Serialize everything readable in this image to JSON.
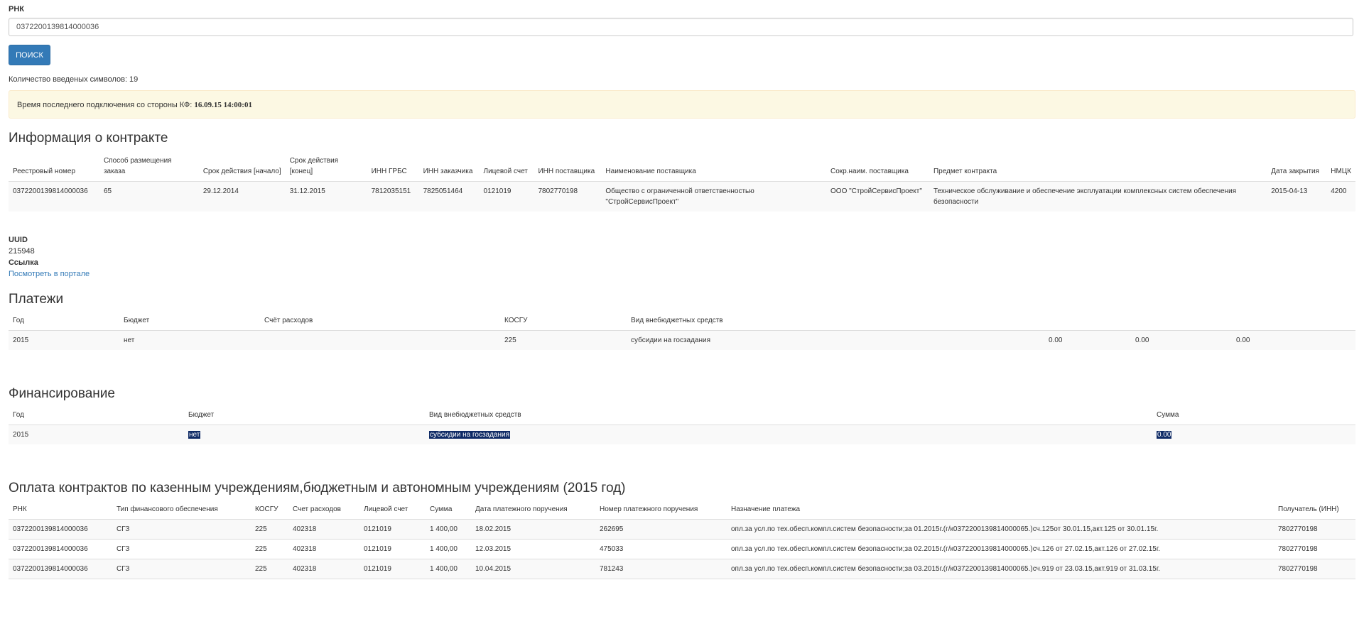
{
  "search": {
    "label": "РНК",
    "value": "0372200139814000036",
    "button": "ПОИСК",
    "char_count": "Количество введеных символов: 19"
  },
  "alert": {
    "text": "Время последнего подключения со стороны КФ: ",
    "timestamp": "16.09.15 14:00:01"
  },
  "contract": {
    "title": "Информация о контракте",
    "headers": [
      "Реестровый номер",
      "Способ размещения заказа",
      "Срок действия [начало]",
      "Срок действия [конец]",
      "ИНН ГРБС",
      "ИНН заказчика",
      "Лицевой счет",
      "ИНН поставщика",
      "Наименование поставщика",
      "Сокр.наим. поставщика",
      "Предмет контракта",
      "Дата закрытия",
      "НМЦК"
    ],
    "row": [
      "0372200139814000036",
      "65",
      "29.12.2014",
      "31.12.2015",
      "7812035151",
      "7825051464",
      "0121019",
      "7802770198",
      "Общество с ограниченной ответственностью \"СтройСервисПроект\"",
      "ООО \"СтройСервисПроект\"",
      "Техническое обслуживание и обеспечение эксплуатации комплексных систем обеспечения безопасности",
      "2015-04-13",
      "4200"
    ]
  },
  "info": {
    "uuid_label": "UUID",
    "uuid_value": "215948",
    "link_label": "Ссылка",
    "link_text": "Посмотреть в портале"
  },
  "payments": {
    "title": "Платежи",
    "headers": [
      "Год",
      "Бюджет",
      "Счёт расходов",
      "КОСГУ",
      "Вид внебюджетных средств",
      "",
      "",
      "",
      ""
    ],
    "row": [
      "2015",
      "нет",
      "",
      "225",
      "субсидии на госзадания",
      "0.00",
      "0.00",
      "0.00",
      ""
    ]
  },
  "financing": {
    "title": "Финансирование",
    "headers": [
      "Год",
      "Бюджет",
      "Вид внебюджетных средств",
      "Сумма"
    ],
    "row": [
      "2015",
      "нет",
      "субсидии на госзадания",
      "0.00"
    ]
  },
  "contract_payments": {
    "title": "Оплата контрактов по казенным учреждениям,бюджетным и автономным учреждениям (2015 год)",
    "headers": [
      "РНК",
      "Тип финансового обеспечения",
      "КОСГУ",
      "Счет расходов",
      "Лицевой счет",
      "Сумма",
      "Дата платежного поручения",
      "Номер платежного поручения",
      "Назначение платежа",
      "Получатель (ИНН)"
    ],
    "rows": [
      [
        "0372200139814000036",
        "СГЗ",
        "225",
        "402318",
        "0121019",
        "1 400,00",
        "18.02.2015",
        "262695",
        "опл.за усл.по тех.обесп.компл.систем безопасности;за 01.2015г.(г/к0372200139814000065.)сч.125от 30.01.15,акт.125 от 30.01.15г.",
        "7802770198"
      ],
      [
        "0372200139814000036",
        "СГЗ",
        "225",
        "402318",
        "0121019",
        "1 400,00",
        "12.03.2015",
        "475033",
        "опл.за усл.по тех.обесп.компл.систем безопасности;за 02.2015г.(г/к0372200139814000065.)сч.126 от 27.02.15,акт.126 от 27.02.15г.",
        "7802770198"
      ],
      [
        "0372200139814000036",
        "СГЗ",
        "225",
        "402318",
        "0121019",
        "1 400,00",
        "10.04.2015",
        "781243",
        "опл.за усл.по тех.обесп.компл.систем безопасности;за 03.2015г.(г/к0372200139814000065.)сч.919 от 23.03.15,акт.919 от 31.03.15г.",
        "7802770198"
      ]
    ]
  }
}
